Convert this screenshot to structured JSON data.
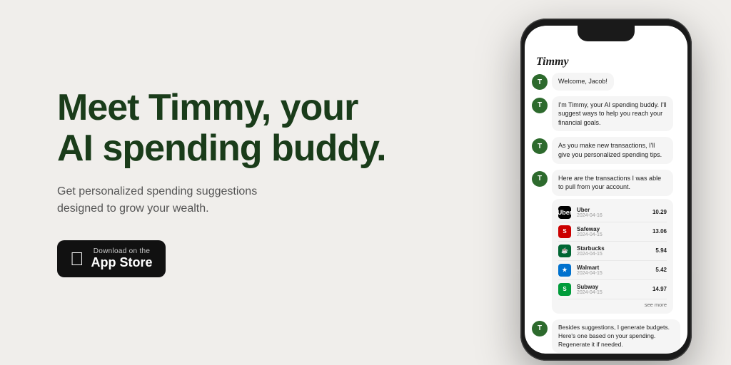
{
  "left": {
    "headline_line1": "Meet Timmy, your",
    "headline_line2": "AI spending buddy.",
    "subtitle": "Get personalized spending suggestions designed to grow your wealth.",
    "app_store_button": {
      "small_label": "Download on the",
      "big_label": "App Store"
    }
  },
  "phone": {
    "app_name": "Timmy",
    "messages": [
      {
        "text": "Welcome, Jacob!"
      },
      {
        "text": "I'm Timmy, your AI spending buddy. I'll suggest ways to help you reach your financial goals."
      },
      {
        "text": "As you make new transactions, I'll give you personalized spending tips."
      },
      {
        "text": "Here are the transactions I was able to pull from your account."
      }
    ],
    "transactions": [
      {
        "name": "Uber",
        "date": "2024-04-16",
        "amount": "10.29",
        "color": "#000000",
        "label": "U"
      },
      {
        "name": "Safeway",
        "date": "2024-04-15",
        "amount": "13.06",
        "color": "#cc0000",
        "label": "S"
      },
      {
        "name": "Starbucks",
        "date": "2024-04-15",
        "amount": "5.94",
        "color": "#006633",
        "label": "☕"
      },
      {
        "name": "Walmart",
        "date": "2024-04-15",
        "amount": "5.42",
        "color": "#0071ce",
        "label": "★"
      },
      {
        "name": "Subway",
        "date": "2024-04-15",
        "amount": "14.97",
        "color": "#009b3a",
        "label": "S"
      }
    ],
    "see_more": "see more",
    "budget_message": "Besides suggestions, I generate budgets. Here's one based on your spending. Regenerate it if needed."
  }
}
